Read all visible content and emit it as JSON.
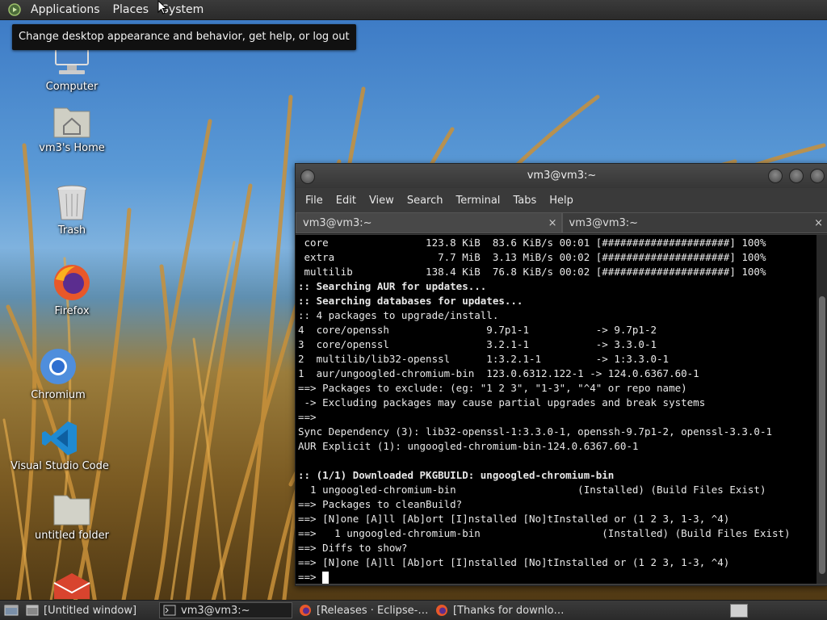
{
  "top_panel": {
    "menus": [
      "Applications",
      "Places",
      "System"
    ],
    "tooltip": "Change desktop appearance and behavior, get help, or log out"
  },
  "desktop": {
    "icons": [
      {
        "label": "Computer",
        "icon": "computer-icon"
      },
      {
        "label": "vm3's Home",
        "icon": "home-folder-icon"
      },
      {
        "label": "Trash",
        "icon": "trash-icon"
      },
      {
        "label": "Firefox",
        "icon": "firefox-icon"
      },
      {
        "label": "Chromium",
        "icon": "chromium-icon"
      },
      {
        "label": "Visual Studio Code",
        "icon": "vscode-icon"
      },
      {
        "label": "untitled folder",
        "icon": "folder-icon"
      },
      {
        "label": "",
        "icon": "app-icon"
      }
    ]
  },
  "terminal": {
    "title": "vm3@vm3:~",
    "menu": [
      "File",
      "Edit",
      "View",
      "Search",
      "Terminal",
      "Tabs",
      "Help"
    ],
    "tabs": [
      {
        "label": "vm3@vm3:~",
        "close": "×"
      },
      {
        "label": "vm3@vm3:~",
        "close": "×"
      }
    ],
    "lines": [
      {
        "text": " core                123.8 KiB  83.6 KiB/s 00:01 [#####################] 100%",
        "bold": false
      },
      {
        "text": " extra                 7.7 MiB  3.13 MiB/s 00:02 [#####################] 100%",
        "bold": false
      },
      {
        "text": " multilib            138.4 KiB  76.8 KiB/s 00:02 [#####################] 100%",
        "bold": false
      },
      {
        "text": ":: Searching AUR for updates...",
        "bold": true
      },
      {
        "text": ":: Searching databases for updates...",
        "bold": true
      },
      {
        "text": ":: 4 packages to upgrade/install.",
        "bold": false
      },
      {
        "text": "4  core/openssh                9.7p1-1           -> 9.7p1-2",
        "bold": false
      },
      {
        "text": "3  core/openssl                3.2.1-1           -> 3.3.0-1",
        "bold": false
      },
      {
        "text": "2  multilib/lib32-openssl      1:3.2.1-1         -> 1:3.3.0-1",
        "bold": false
      },
      {
        "text": "1  aur/ungoogled-chromium-bin  123.0.6312.122-1 -> 124.0.6367.60-1",
        "bold": false
      },
      {
        "text": "==> Packages to exclude: (eg: \"1 2 3\", \"1-3\", \"^4\" or repo name)",
        "bold": false
      },
      {
        "text": " -> Excluding packages may cause partial upgrades and break systems",
        "bold": false
      },
      {
        "text": "==>",
        "bold": false
      },
      {
        "text": "Sync Dependency (3): lib32-openssl-1:3.3.0-1, openssh-9.7p1-2, openssl-3.3.0-1",
        "bold": false
      },
      {
        "text": "AUR Explicit (1): ungoogled-chromium-bin-124.0.6367.60-1",
        "bold": false
      },
      {
        "text": "",
        "bold": false
      },
      {
        "text": ":: (1/1) Downloaded PKGBUILD: ungoogled-chromium-bin",
        "bold": true
      },
      {
        "text": "  1 ungoogled-chromium-bin                    (Installed) (Build Files Exist)",
        "bold": false
      },
      {
        "text": "==> Packages to cleanBuild?",
        "bold": false
      },
      {
        "text": "==> [N]one [A]ll [Ab]ort [I]nstalled [No]tInstalled or (1 2 3, 1-3, ^4)",
        "bold": false
      },
      {
        "text": "==>   1 ungoogled-chromium-bin                    (Installed) (Build Files Exist)",
        "bold": false
      },
      {
        "text": "==> Diffs to show?",
        "bold": false
      },
      {
        "text": "==> [N]one [A]ll [Ab]ort [I]nstalled [No]tInstalled or (1 2 3, 1-3, ^4)",
        "bold": false
      }
    ],
    "prompt": "==> "
  },
  "taskbar": {
    "tasks": [
      {
        "label": "[Untitled window]",
        "icon": "window-icon",
        "active": false
      },
      {
        "label": "vm3@vm3:~",
        "icon": "terminal-icon",
        "active": true
      },
      {
        "label": "[Releases · Eclipse-…",
        "icon": "firefox-icon",
        "active": false
      },
      {
        "label": "[Thanks for downlo…",
        "icon": "firefox-icon",
        "active": false
      }
    ]
  }
}
